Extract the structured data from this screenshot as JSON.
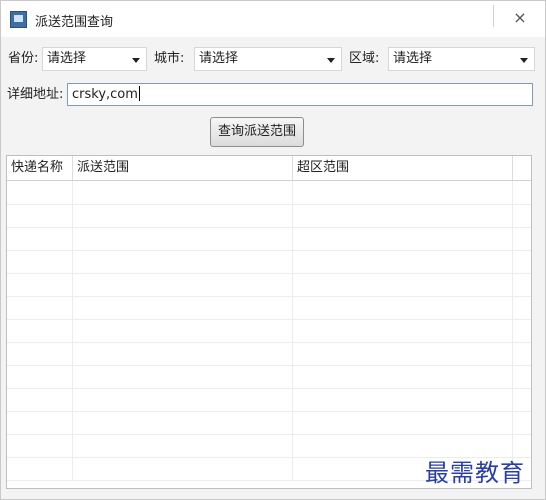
{
  "window": {
    "title": "派送范围查询",
    "close_glyph": "×"
  },
  "filters": {
    "province_label": "省份:",
    "province_value": "请选择",
    "city_label": "城市:",
    "city_value": "请选择",
    "district_label": "区域:",
    "district_value": "请选择"
  },
  "address": {
    "label": "详细地址:",
    "value": "crsky,com"
  },
  "query_button": "查询派送范围",
  "table": {
    "columns": [
      "快递名称",
      "派送范围",
      "超区范围"
    ],
    "row_count": 13
  },
  "watermark": "最需教育"
}
